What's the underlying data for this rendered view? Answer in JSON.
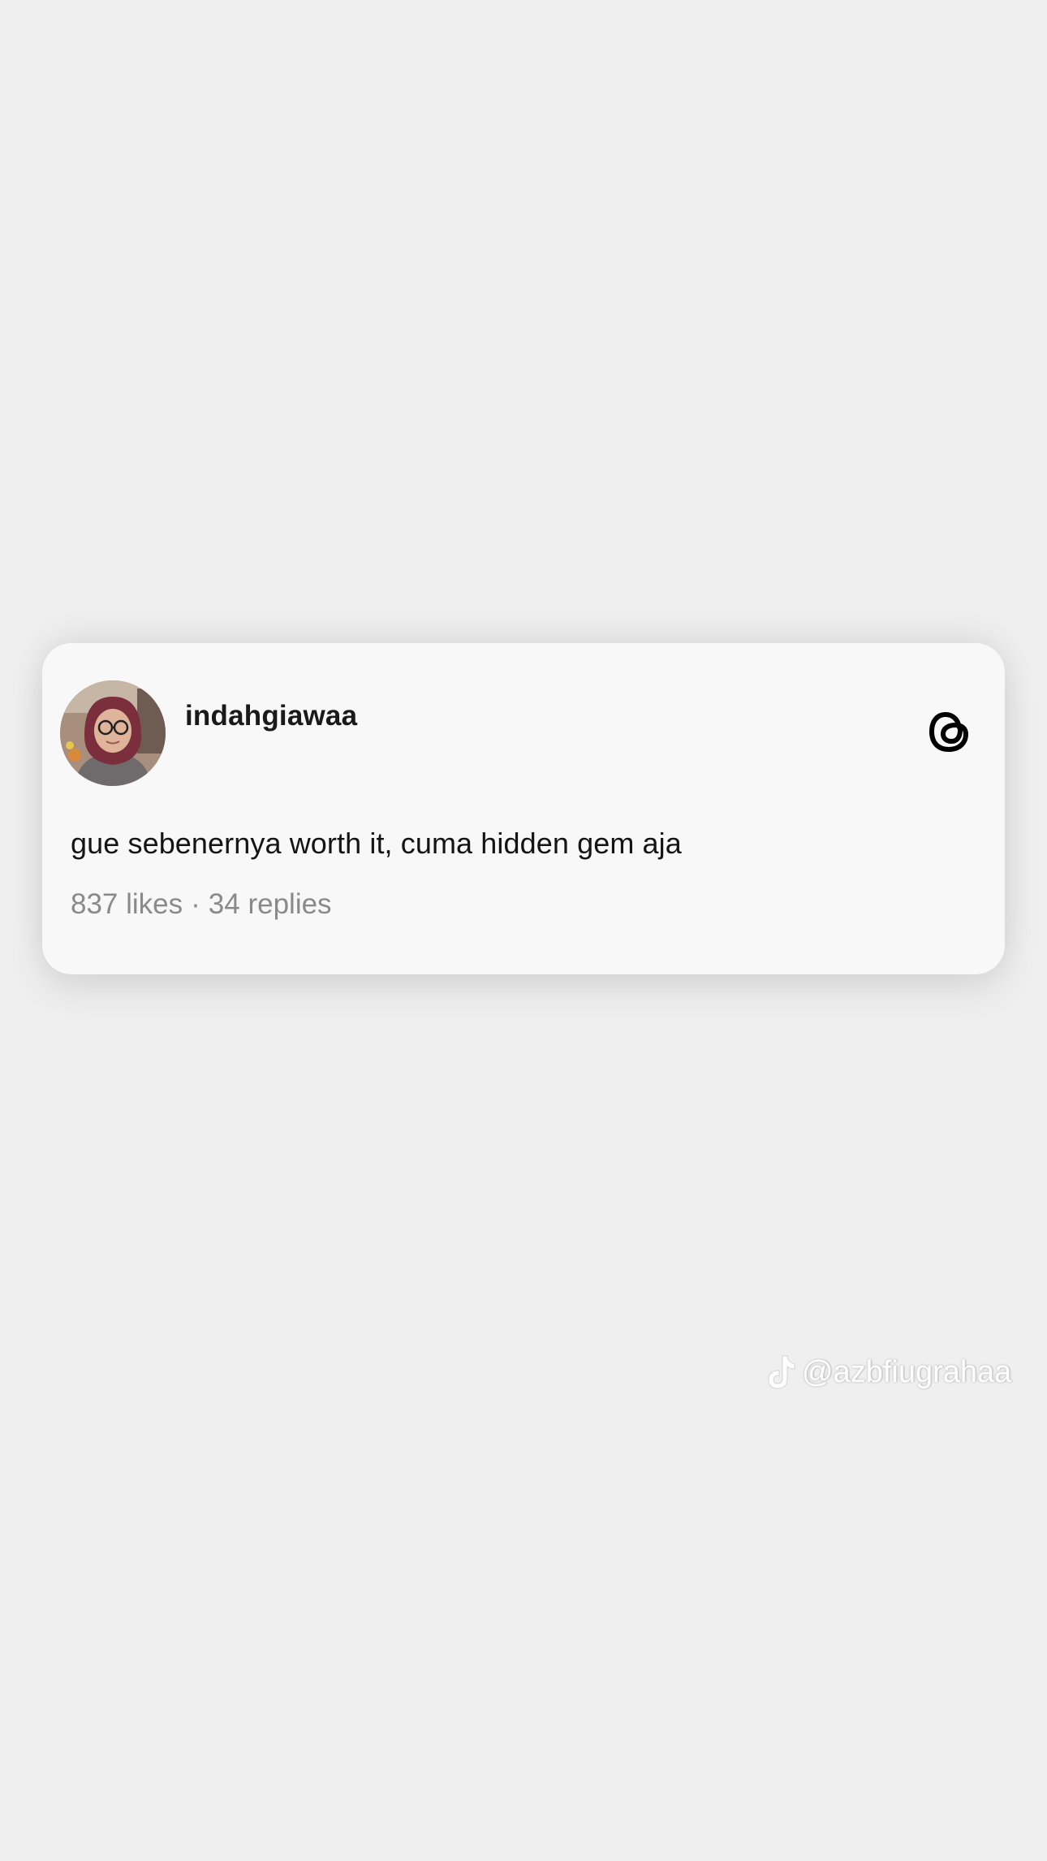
{
  "post": {
    "username": "indahgiawaa",
    "text": "gue sebenernya worth it, cuma hidden gem aja",
    "likes": "837 likes",
    "separator": "·",
    "replies": "34 replies",
    "avatar_icon": "profile-photo-avatar",
    "platform_icon": "threads-logo-icon"
  },
  "watermark": {
    "handle": "@azbfiugrahaa",
    "icon": "tiktok-logo-icon"
  },
  "colors": {
    "background": "#efefef",
    "card": "#f8f8f8",
    "text": "#141414",
    "muted": "#8a8a8a"
  }
}
